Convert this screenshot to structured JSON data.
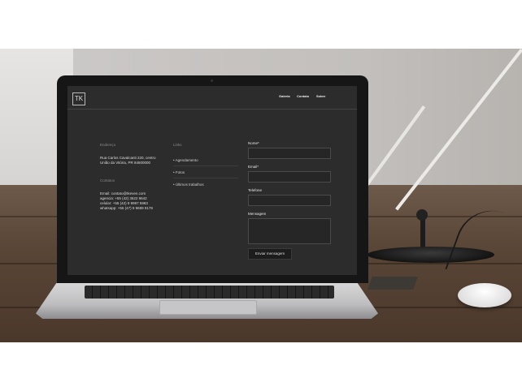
{
  "site": {
    "logo_text": "TK",
    "nav": [
      "Galeria",
      "Contato",
      "Sobre"
    ],
    "address": {
      "title": "Endereço",
      "line1": "Rua Carlos Cavalcanti 220, centro",
      "line2": "União da Vitória, PR 84600000"
    },
    "contacts": {
      "title": "Contatos",
      "email": "Email: contato@tkeven.com",
      "agencia": "agencia: +55 (42) 3522 9642",
      "celular": "celular: +55 (42) 9 9997 5983",
      "whatsapp": "whatsapp: +55 (47) 9 9689 9179"
    },
    "links": {
      "title": "Links",
      "items": [
        "Agendamento",
        "Fotos",
        "Últimos trabalhos"
      ]
    },
    "form": {
      "name_label": "Nome*",
      "email_label": "Email*",
      "phone_label": "Telefone",
      "message_label": "Mensagem",
      "submit_label": "Enviar mensagem"
    }
  }
}
